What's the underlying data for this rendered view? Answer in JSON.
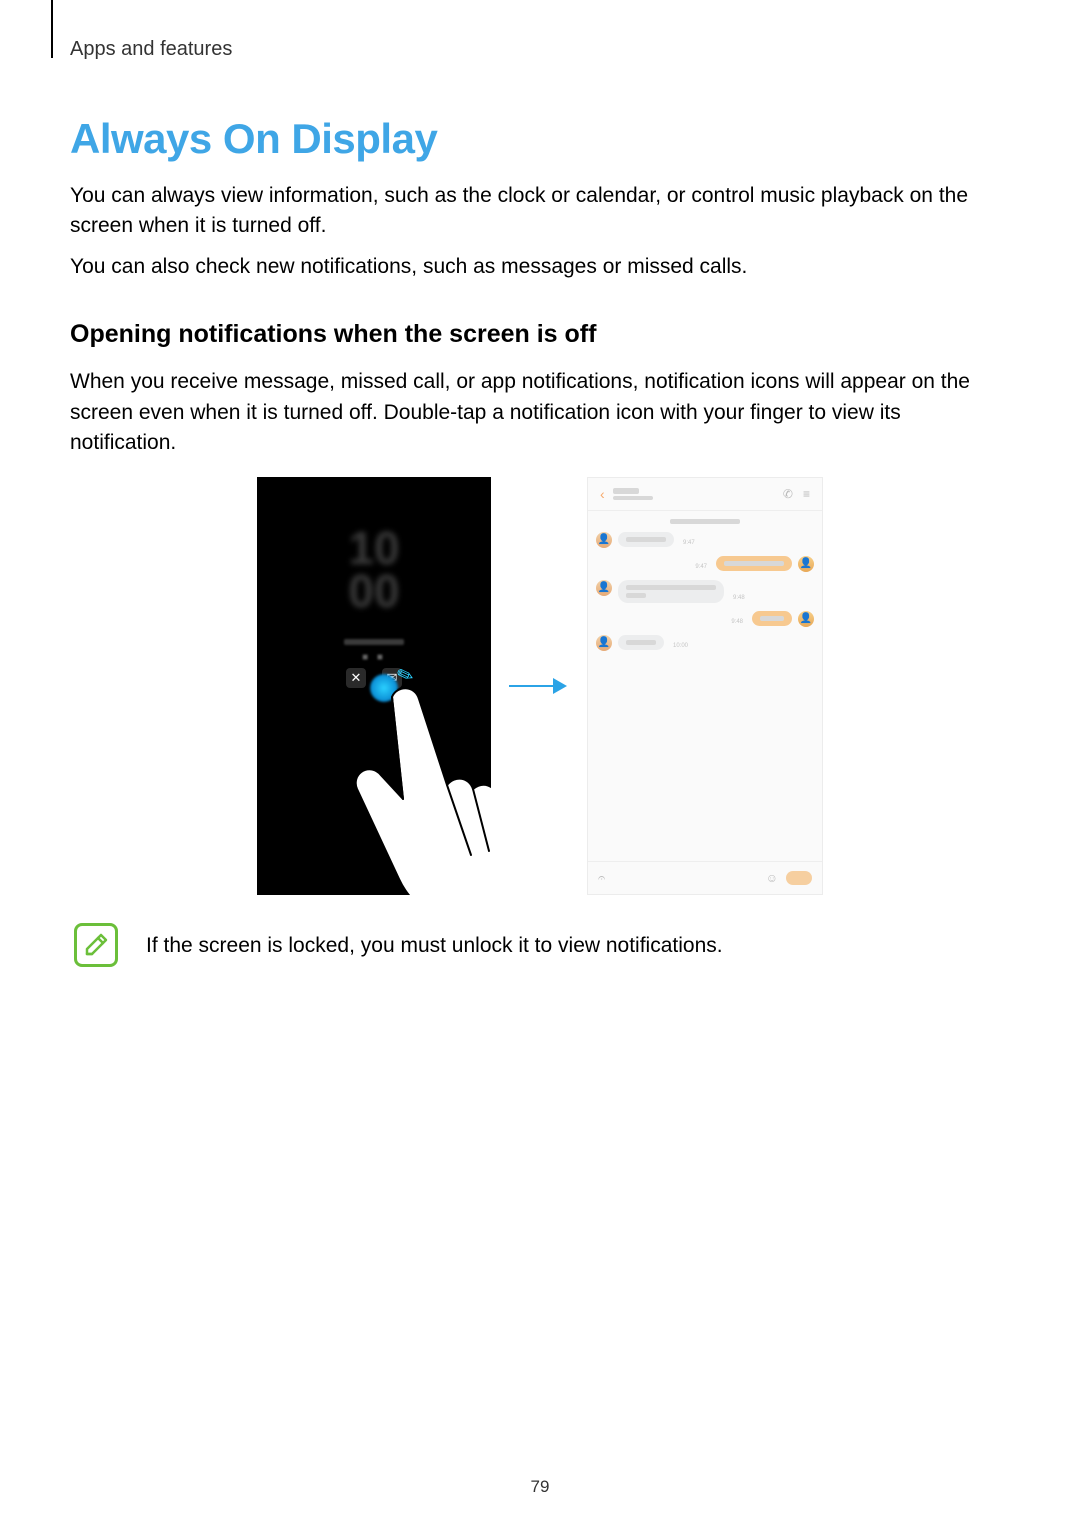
{
  "header": {
    "section": "Apps and features"
  },
  "title": "Always On Display",
  "para1": "You can always view information, such as the clock or calendar, or control music playback on the screen when it is turned off.",
  "para2": "You can also check new notifications, such as messages or missed calls.",
  "subheading": "Opening notifications when the screen is off",
  "para3": "When you receive message, missed call, or app notifications, notification icons will appear on the screen even when it is turned off. Double-tap a notification icon with your finger to view its notification.",
  "aod": {
    "time_top": "10",
    "time_bot": "00",
    "missed_glyph": "✕",
    "msg_glyph": "✉",
    "draw_glyph": "✎"
  },
  "messages": {
    "back_glyph": "‹",
    "call_glyph": "✆",
    "menu_glyph": "≡",
    "ts1": "9:47",
    "ts2": "9:47",
    "ts3": "9:48",
    "ts4": "9:48",
    "ts5": "10:00",
    "avatar_glyph": "👤",
    "clip_glyph": "𝄐",
    "smile_glyph": "☺"
  },
  "note": {
    "glyph": "✎",
    "text": "If the screen is locked, you must unlock it to view notifications."
  },
  "page_number": "79"
}
